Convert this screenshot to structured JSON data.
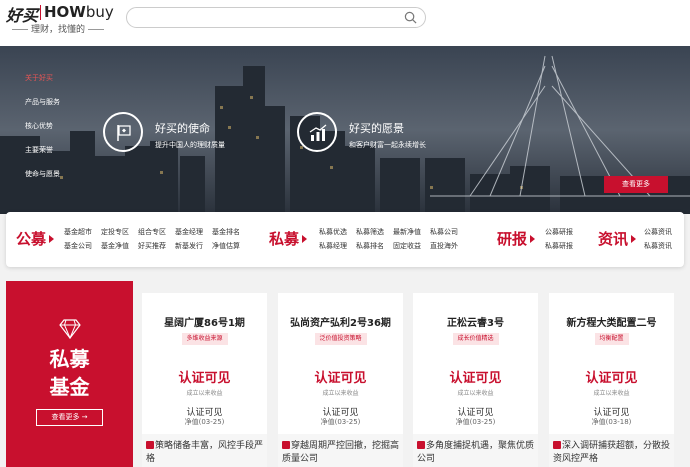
{
  "header": {
    "logo_cn": "好买",
    "logo_how": "HOW",
    "logo_buy": "buy",
    "slogan": "理财，找懂的",
    "search_placeholder": ""
  },
  "banner": {
    "side_nav": [
      {
        "label": "关于好买",
        "active": true
      },
      {
        "label": "产品与服务",
        "active": false
      },
      {
        "label": "核心优势",
        "active": false
      },
      {
        "label": "主要荣誉",
        "active": false
      },
      {
        "label": "使命与愿景",
        "active": false
      }
    ],
    "mission": {
      "title": "好买的使命",
      "subtitle": "提升中国人的理财质量"
    },
    "vision": {
      "title": "好买的愿景",
      "subtitle": "和客户财富一起永续增长"
    },
    "more_label": "查看更多"
  },
  "product_nav": [
    {
      "title": "公募",
      "links": [
        "基金超市",
        "基金公司",
        "定投专区",
        "基金净值",
        "组合专区",
        "好买推荐",
        "基金经理",
        "新基发行",
        "基金排名",
        "净值估算"
      ]
    },
    {
      "title": "私募",
      "links": [
        "私募优选",
        "私募经理",
        "私募筛选",
        "私募排名",
        "最新净值",
        "固定收益",
        "私募公司",
        "直投海外"
      ]
    },
    {
      "title": "研报",
      "links": [
        "公募研报",
        "私募研报"
      ]
    },
    {
      "title": "资讯",
      "links": [
        "公募资讯",
        "私募资讯"
      ]
    }
  ],
  "private_panel": {
    "title_line1": "私募",
    "title_line2": "基金",
    "button": "查看更多 →"
  },
  "cards": [
    {
      "name": "星阔广厦86号1期",
      "tag": "多维收益来源",
      "main": "认证可见",
      "main_sub": "成立以来收益",
      "value": "认证可见",
      "nav": "净值(03-25)",
      "desc": "策略储备丰富，风控手段严格"
    },
    {
      "name": "弘尚资产弘利2号36期",
      "tag": "泛价值投资策略",
      "main": "认证可见",
      "main_sub": "成立以来收益",
      "value": "认证可见",
      "nav": "净值(03-25)",
      "desc": "穿越周期严控回撤，挖掘高质量公司"
    },
    {
      "name": "正松云睿3号",
      "tag": "成长价值精选",
      "main": "认证可见",
      "main_sub": "成立以来收益",
      "value": "认证可见",
      "nav": "净值(03-25)",
      "desc": "多角度捕捉机遇，聚焦优质公司"
    },
    {
      "name": "新方程大类配置二号",
      "tag": "均衡配置",
      "main": "认证可见",
      "main_sub": "成立以来收益",
      "value": "认证可见",
      "nav": "净值(03-18)",
      "desc": "深入调研捕获超额，分散投资风控严格"
    }
  ],
  "colors": {
    "brand_red": "#c8102e"
  }
}
